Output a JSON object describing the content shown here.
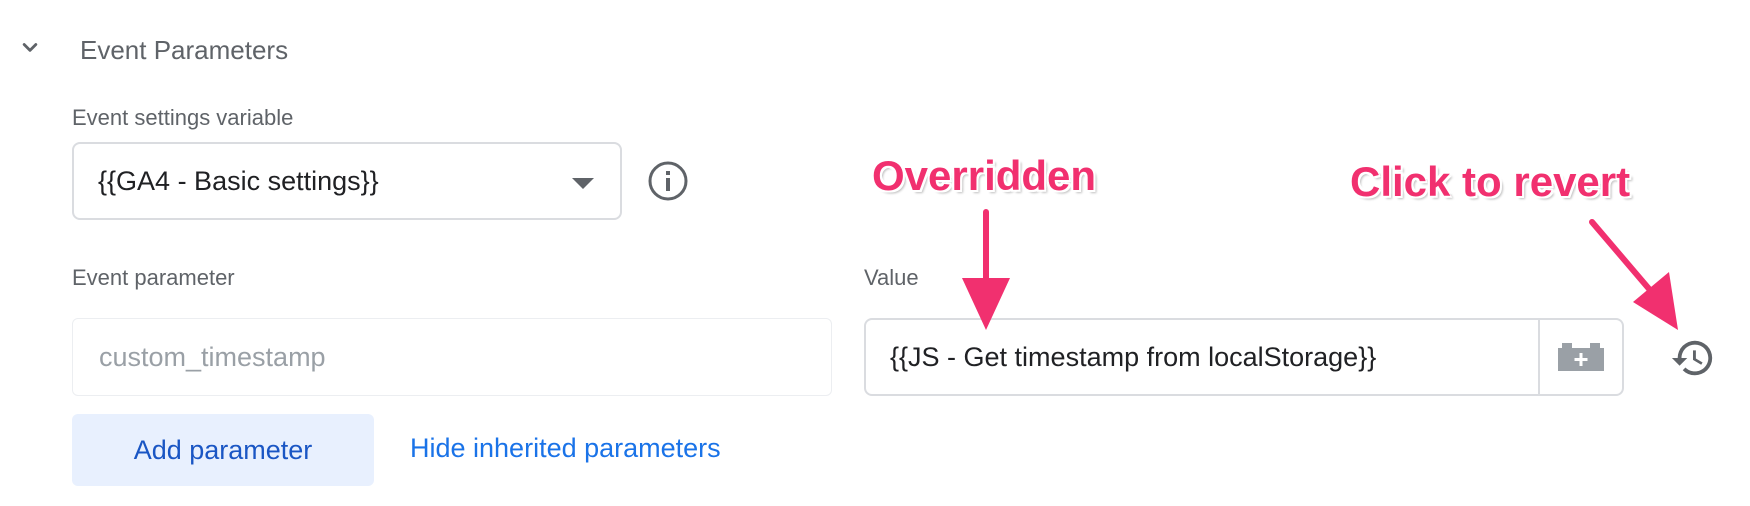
{
  "section": {
    "title": "Event Parameters",
    "icon": "chevron-down-icon"
  },
  "settings_variable": {
    "label": "Event settings variable",
    "value": "{{GA4 - Basic settings}}",
    "info_icon": "info-icon"
  },
  "parameters": {
    "param_label": "Event parameter",
    "value_label": "Value",
    "rows": [
      {
        "param_placeholder": "custom_timestamp",
        "value": "{{JS - Get timestamp from localStorage}}",
        "variable_icon": "add-variable-icon",
        "revert_icon": "revert-history-icon"
      }
    ]
  },
  "actions": {
    "add_label": "Add parameter",
    "hide_label": "Hide inherited parameters"
  },
  "annotations": {
    "overridden": "Overridden",
    "revert": "Click to revert",
    "color": "#f1306f"
  }
}
